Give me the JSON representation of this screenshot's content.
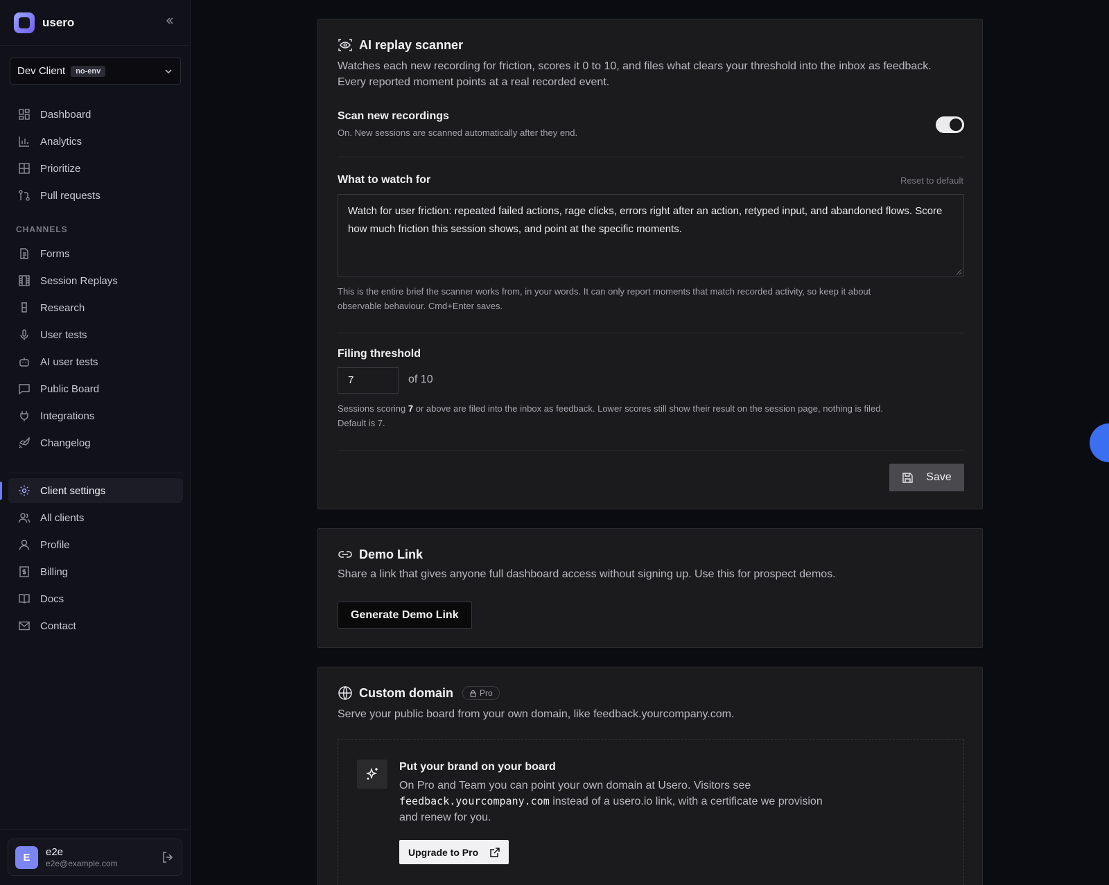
{
  "app": {
    "name": "usero"
  },
  "client_select": {
    "name": "Dev Client",
    "env": "no-env"
  },
  "nav": {
    "main": [
      "Dashboard",
      "Analytics",
      "Prioritize",
      "Pull requests"
    ],
    "channels_label": "CHANNELS",
    "channels": [
      "Forms",
      "Session Replays",
      "Research",
      "User tests",
      "AI user tests",
      "Public Board",
      "Integrations",
      "Changelog"
    ],
    "account": [
      "Client settings",
      "All clients",
      "Profile",
      "Billing",
      "Docs",
      "Contact"
    ]
  },
  "user": {
    "initial": "E",
    "name": "e2e",
    "email": "e2e@example.com"
  },
  "scanner": {
    "title": "AI replay scanner",
    "desc_line1": "Watches each new recording for friction, scores it 0 to 10, and files what clears your threshold into the inbox as feedback.",
    "desc_line2": "Every reported moment points at a real recorded event.",
    "scan_title": "Scan new recordings",
    "scan_status": "On. New sessions are scanned automatically after they end.",
    "watch_title": "What to watch for",
    "reset": "Reset to default",
    "brief": "Watch for user friction: repeated failed actions, rage clicks, errors right after an action, retyped input, and abandoned flows. Score how much friction this session shows, and point at the specific moments.",
    "brief_hint_line1": "This is the entire brief the scanner works from, in your words. It can only report moments that match recorded activity, so keep it about",
    "brief_hint_line2": "observable behaviour. Cmd+Enter saves.",
    "threshold_title": "Filing threshold",
    "threshold_value": "7",
    "threshold_of": "of 10",
    "threshold_hint_pre": "Sessions scoring",
    "threshold_hint_bold": "7",
    "threshold_hint_post": "or above are filed into the inbox as feedback. Lower scores still show their result on the session page, nothing is filed.",
    "threshold_hint_line2": "Default is 7.",
    "save": "Save"
  },
  "demo": {
    "title": "Demo Link",
    "desc": "Share a link that gives anyone full dashboard access without signing up. Use this for prospect demos.",
    "button": "Generate Demo Link"
  },
  "domain": {
    "title": "Custom domain",
    "badge": "Pro",
    "desc": "Serve your public board from your own domain, like feedback.yourcompany.com.",
    "upsell_title": "Put your brand on your board",
    "upsell_body_1": "On Pro and Team you can point your own domain at Usero. Visitors see",
    "upsell_code": "feedback.yourcompany.com",
    "upsell_body_2": "instead of a usero.io link, with a certificate we provision",
    "upsell_body_3": "and renew for you.",
    "upgrade": "Upgrade to Pro"
  },
  "colors": {
    "accent": "#6d7cff",
    "fab": "#3b6ff2",
    "background": "#0b0b12",
    "card": "#1b1b1d"
  }
}
